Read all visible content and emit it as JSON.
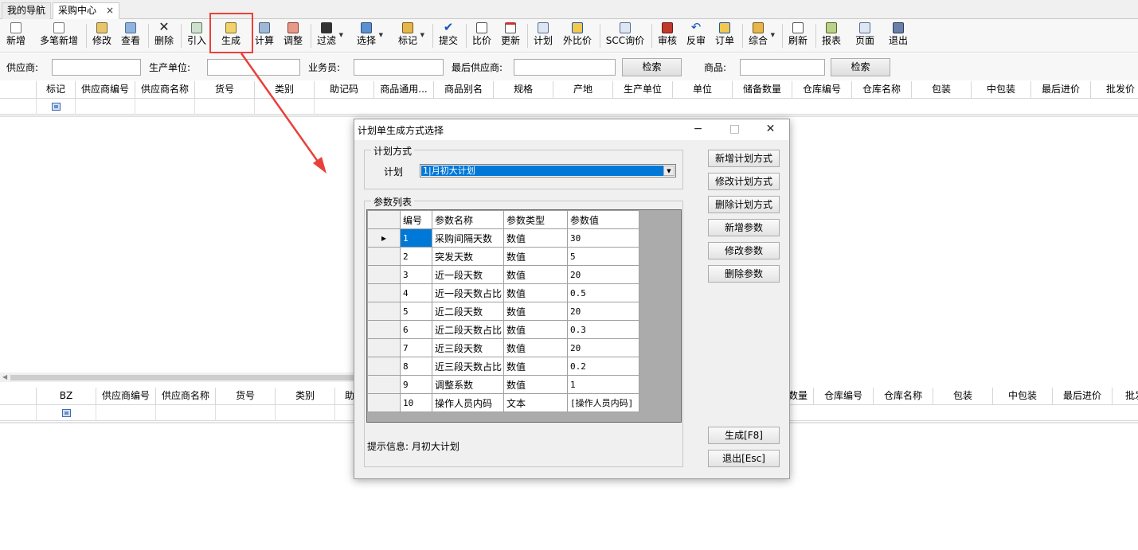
{
  "tabs": {
    "home": "我的导航",
    "purchase": "采购中心",
    "close": "×"
  },
  "toolbar": {
    "new": "新增",
    "multi_new": "多笔新增",
    "edit": "修改",
    "view": "查看",
    "delete": "删除",
    "import": "引入",
    "generate": "生成",
    "calc": "计算",
    "adjust": "调整",
    "filter": "过滤",
    "select": "选择",
    "mark": "标记",
    "submit": "提交",
    "compare": "比价",
    "update": "更新",
    "plan": "计划",
    "ext_compare": "外比价",
    "scc": "SCC询价",
    "audit": "审核",
    "unaudit": "反审",
    "order": "订单",
    "general": "综合",
    "refresh": "刷新",
    "report": "报表",
    "page": "页面",
    "exit": "退出"
  },
  "filter": {
    "supplier_label": "供应商:",
    "maker_label": "生产单位:",
    "staff_label": "业务员:",
    "last_supplier_label": "最后供应商:",
    "search1": "检索",
    "goods_label": "商品:",
    "search2": "检索"
  },
  "top_grid": {
    "columns": [
      "标记",
      "供应商编号",
      "供应商名称",
      "货号",
      "类别",
      "助记码",
      "商品通用...",
      "商品别名",
      "规格",
      "产地",
      "生产单位",
      "单位",
      "储备数量",
      "仓库编号",
      "仓库名称",
      "包装",
      "中包装",
      "最后进价",
      "批发价"
    ]
  },
  "bottom_grid": {
    "columns": [
      "BZ",
      "供应商编号",
      "供应商名称",
      "货号",
      "类别",
      "助",
      "数量",
      "仓库编号",
      "仓库名称",
      "包装",
      "中包装",
      "最后进价",
      "批发"
    ]
  },
  "dialog": {
    "title": "计划单生成方式选择",
    "min": "−",
    "max": "□",
    "close": "✕",
    "plan_group": "计划方式",
    "plan_label": "计划",
    "plan_value": "1|月初大计划",
    "param_group": "参数列表",
    "columns": [
      "编号",
      "参数名称",
      "参数类型",
      "参数值"
    ],
    "rows": [
      {
        "id": "1",
        "name": "采购间隔天数",
        "type": "数值",
        "value": "30"
      },
      {
        "id": "2",
        "name": "突发天数",
        "type": "数值",
        "value": "5"
      },
      {
        "id": "3",
        "name": "近一段天数",
        "type": "数值",
        "value": "20"
      },
      {
        "id": "4",
        "name": "近一段天数占比",
        "type": "数值",
        "value": "0.5"
      },
      {
        "id": "5",
        "name": "近二段天数",
        "type": "数值",
        "value": "20"
      },
      {
        "id": "6",
        "name": "近二段天数占比",
        "type": "数值",
        "value": "0.3"
      },
      {
        "id": "7",
        "name": "近三段天数",
        "type": "数值",
        "value": "20"
      },
      {
        "id": "8",
        "name": "近三段天数占比",
        "type": "数值",
        "value": "0.2"
      },
      {
        "id": "9",
        "name": "调整系数",
        "type": "数值",
        "value": "1"
      },
      {
        "id": "10",
        "name": "操作人员内码",
        "type": "文本",
        "value": "[操作人员内码]"
      }
    ],
    "buttons": {
      "add_plan": "新增计划方式",
      "edit_plan": "修改计划方式",
      "del_plan": "删除计划方式",
      "add_param": "新增参数",
      "edit_param": "修改参数",
      "del_param": "删除参数",
      "generate": "生成[F8]",
      "exit": "退出[Esc]"
    },
    "hint_label": "提示信息:",
    "hint_value": "月初大计划"
  },
  "colors": {
    "highlight": "#e8413b",
    "selection": "#0078d7"
  }
}
